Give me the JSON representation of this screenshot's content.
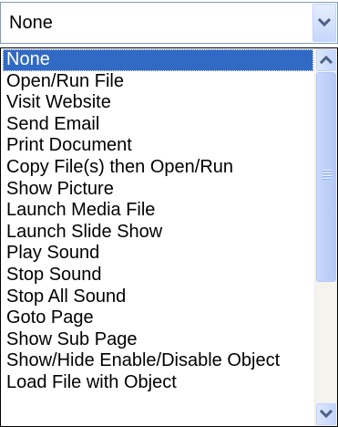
{
  "combo": {
    "value": "None",
    "button_icon": "chevron-down-icon"
  },
  "list": {
    "selected_index": 0,
    "items": [
      "None",
      "Open/Run File",
      "Visit Website",
      "Send Email",
      "Print Document",
      "Copy File(s) then Open/Run",
      "Show Picture",
      "Launch Media File",
      "Launch Slide Show",
      "Play Sound",
      "Stop Sound",
      "Stop All Sound",
      "Goto Page",
      "Show Sub Page",
      "Show/Hide Enable/Disable Object",
      "Load File with Object"
    ]
  },
  "scrollbar": {
    "up_icon": "chevron-up-icon",
    "down_icon": "chevron-down-icon"
  },
  "colors": {
    "selection": "#316ac5",
    "arrow": "#4d6185",
    "border": "#7f9db9"
  }
}
